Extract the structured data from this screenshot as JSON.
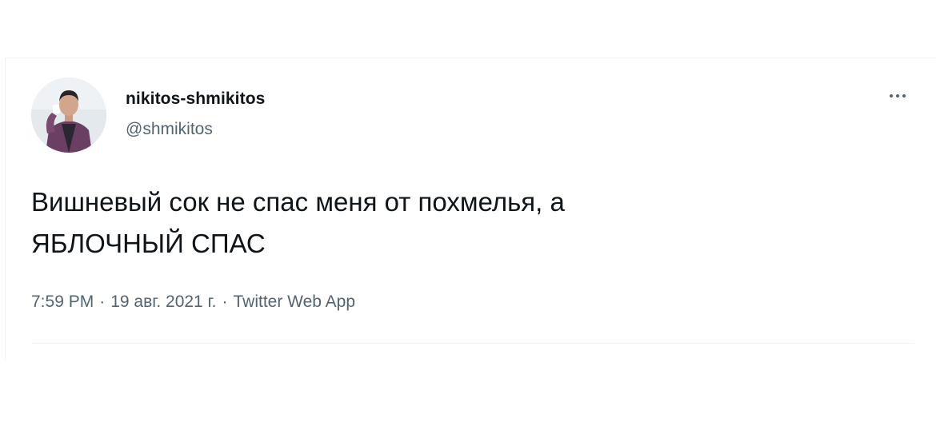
{
  "tweet": {
    "author": {
      "display_name": "nikitos-shmikitos",
      "handle": "@shmikitos",
      "avatar_icon": "user-avatar-photo"
    },
    "text": "Вишневый сок не спас меня от похмелья, а\nЯБЛОЧНЫЙ СПАС",
    "time": "7:59 PM",
    "date": "19 авг. 2021 г.",
    "source": "Twitter Web App",
    "separator": "·",
    "more_icon": "more-horizontal-icon"
  },
  "colors": {
    "text_primary": "#0f1419",
    "text_secondary": "#536471",
    "border": "#eff3f4"
  }
}
